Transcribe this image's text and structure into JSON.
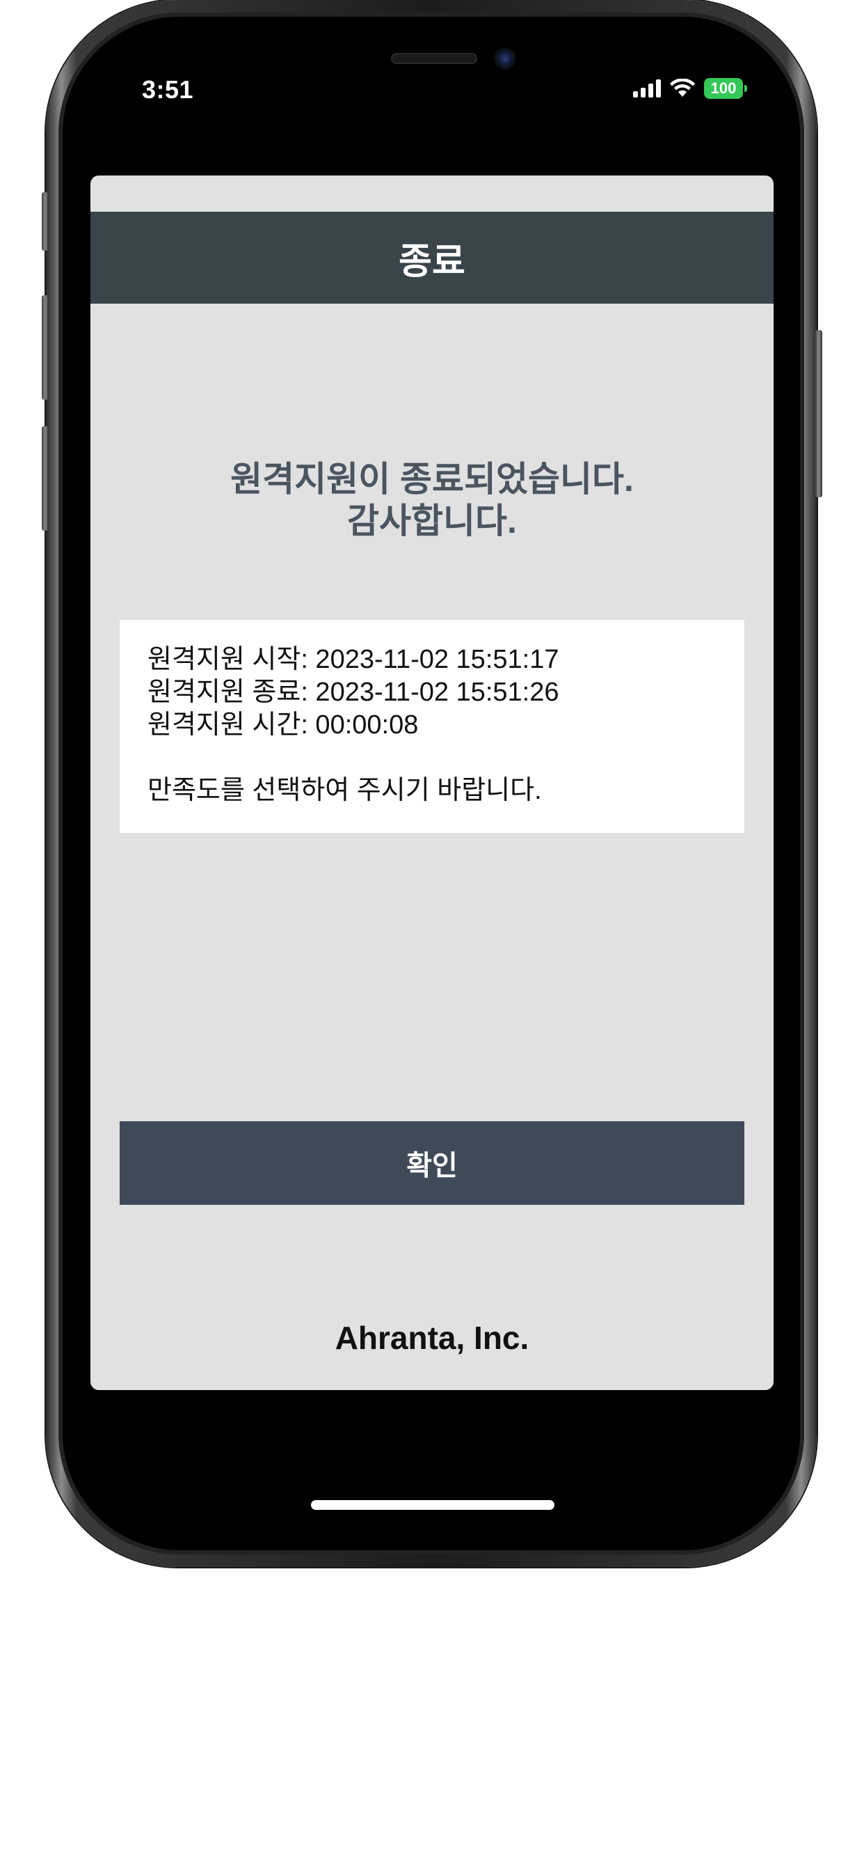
{
  "status_bar": {
    "time": "3:51",
    "battery": "100"
  },
  "app": {
    "title": "종료",
    "message_line1": "원격지원이 종료되었습니다.",
    "message_line2": "감사합니다.",
    "info": {
      "start": "원격지원 시작: 2023-11-02 15:51:17",
      "end": "원격지원 종료: 2023-11-02 15:51:26",
      "duration": "원격지원 시간: 00:00:08",
      "prompt": "만족도를 선택하여 주시기 바랍니다."
    },
    "confirm_label": "확인",
    "footer": "Ahranta, Inc."
  },
  "colors": {
    "header_bg": "#39444b",
    "button_bg": "#3e4a57",
    "app_bg": "#e1e1e1",
    "battery": "#35c759"
  },
  "icons": [
    "signal-icon",
    "wifi-icon",
    "battery-icon"
  ]
}
